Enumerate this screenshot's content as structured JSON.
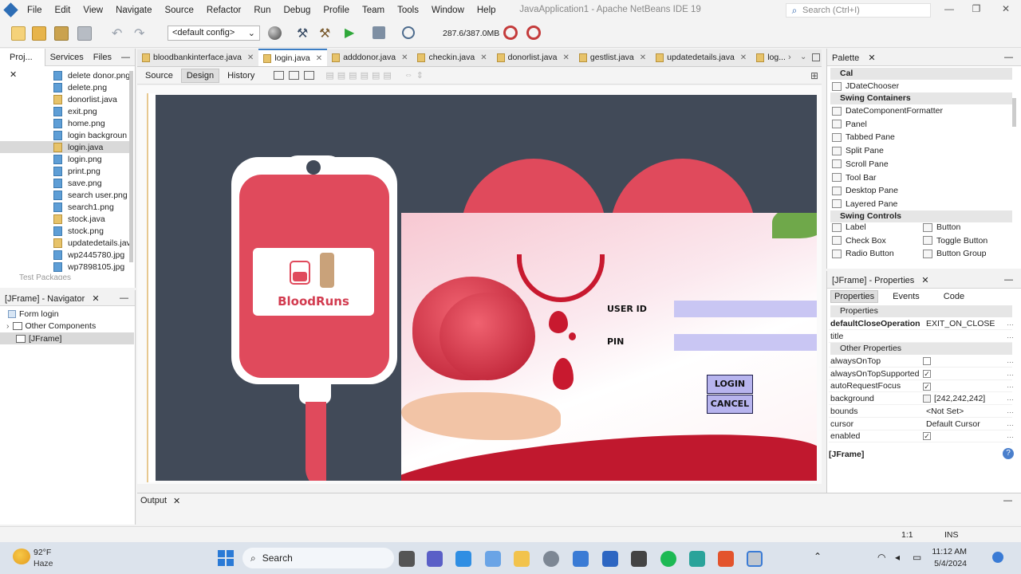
{
  "window": {
    "title": "JavaApplication1 - Apache NetBeans IDE 19",
    "menu": [
      "File",
      "Edit",
      "View",
      "Navigate",
      "Source",
      "Refactor",
      "Run",
      "Debug",
      "Profile",
      "Team",
      "Tools",
      "Window",
      "Help"
    ],
    "search_placeholder": "Search (Ctrl+I)"
  },
  "toolbar": {
    "config": "<default config>",
    "memory": "287.6/387.0MB"
  },
  "projects": {
    "tabs": [
      "Proj...",
      "Services",
      "Files"
    ],
    "files": [
      {
        "name": "delete donor.png",
        "type": "png"
      },
      {
        "name": "delete.png",
        "type": "png"
      },
      {
        "name": "donorlist.java",
        "type": "java"
      },
      {
        "name": "exit.png",
        "type": "png"
      },
      {
        "name": "home.png",
        "type": "png"
      },
      {
        "name": "login backgroun",
        "type": "png"
      },
      {
        "name": "login.java",
        "type": "java",
        "selected": true
      },
      {
        "name": "login.png",
        "type": "png"
      },
      {
        "name": "print.png",
        "type": "png"
      },
      {
        "name": "save.png",
        "type": "png"
      },
      {
        "name": "search user.png",
        "type": "png"
      },
      {
        "name": "search1.png",
        "type": "png"
      },
      {
        "name": "stock.java",
        "type": "java"
      },
      {
        "name": "stock.png",
        "type": "png"
      },
      {
        "name": "updatedetails.jav",
        "type": "java"
      },
      {
        "name": "wp2445780.jpg",
        "type": "png"
      },
      {
        "name": "wp7898105.jpg",
        "type": "png"
      }
    ],
    "partial_item": "Test Packages"
  },
  "navigator": {
    "title": "[JFrame] - Navigator",
    "form": "Form login",
    "other": "Other Components",
    "jframe": "[JFrame]"
  },
  "editor": {
    "tabs": [
      "bloodbankinterface.java",
      "login.java",
      "adddonor.java",
      "checkin.java",
      "donorlist.java",
      "gestlist.java",
      "updatedetails.java",
      "log..."
    ],
    "active_tab": "login.java",
    "view_buttons": [
      "Source",
      "Design",
      "History"
    ]
  },
  "form": {
    "brand": "BloodRuns",
    "user_id_label": "USER ID",
    "pin_label": "PIN",
    "login_button": "LOGIN",
    "cancel_button": "CANCEL",
    "colors": {
      "background": "#414a58",
      "accent": "#e04a5c",
      "input": "#c9c6f3"
    }
  },
  "palette": {
    "title": "Palette",
    "cal_category": "Cal",
    "cal_item": "JDateChooser",
    "containers_category": "Swing Containers",
    "containers": [
      "DateComponentFormatter",
      "Panel",
      "Tabbed Pane",
      "Split Pane",
      "Scroll Pane",
      "Tool Bar",
      "Desktop Pane",
      "Layered Pane"
    ],
    "controls_category": "Swing Controls",
    "controls_left": [
      "Label",
      "Check Box",
      "Radio Button"
    ],
    "controls_right": [
      "Button",
      "Toggle Button",
      "Button Group"
    ]
  },
  "properties": {
    "title": "[JFrame] - Properties",
    "tabs": [
      "Properties",
      "Events",
      "Code"
    ],
    "section1": "Properties",
    "section2": "Other Properties",
    "rows1": [
      {
        "key": "defaultCloseOperation",
        "value": "EXIT_ON_CLOSE"
      },
      {
        "key": "title",
        "value": ""
      }
    ],
    "rows2": [
      {
        "key": "alwaysOnTop",
        "value": "",
        "check": "off"
      },
      {
        "key": "alwaysOnTopSupported",
        "value": "",
        "check": "on"
      },
      {
        "key": "autoRequestFocus",
        "value": "",
        "check": "on"
      },
      {
        "key": "background",
        "value": "[242,242,242]",
        "check": "swatch"
      },
      {
        "key": "bounds",
        "value": "<Not Set>",
        "check": "none"
      },
      {
        "key": "cursor",
        "value": "Default Cursor",
        "check": "none"
      },
      {
        "key": "enabled",
        "value": "",
        "check": "on"
      }
    ],
    "footer": "[JFrame]"
  },
  "output": {
    "title": "Output"
  },
  "status": {
    "position": "1:1",
    "mode": "INS"
  },
  "taskbar": {
    "weather_temp": "92°F",
    "weather_desc": "Haze",
    "search": "Search",
    "time": "11:12 AM",
    "date": "5/4/2024"
  }
}
